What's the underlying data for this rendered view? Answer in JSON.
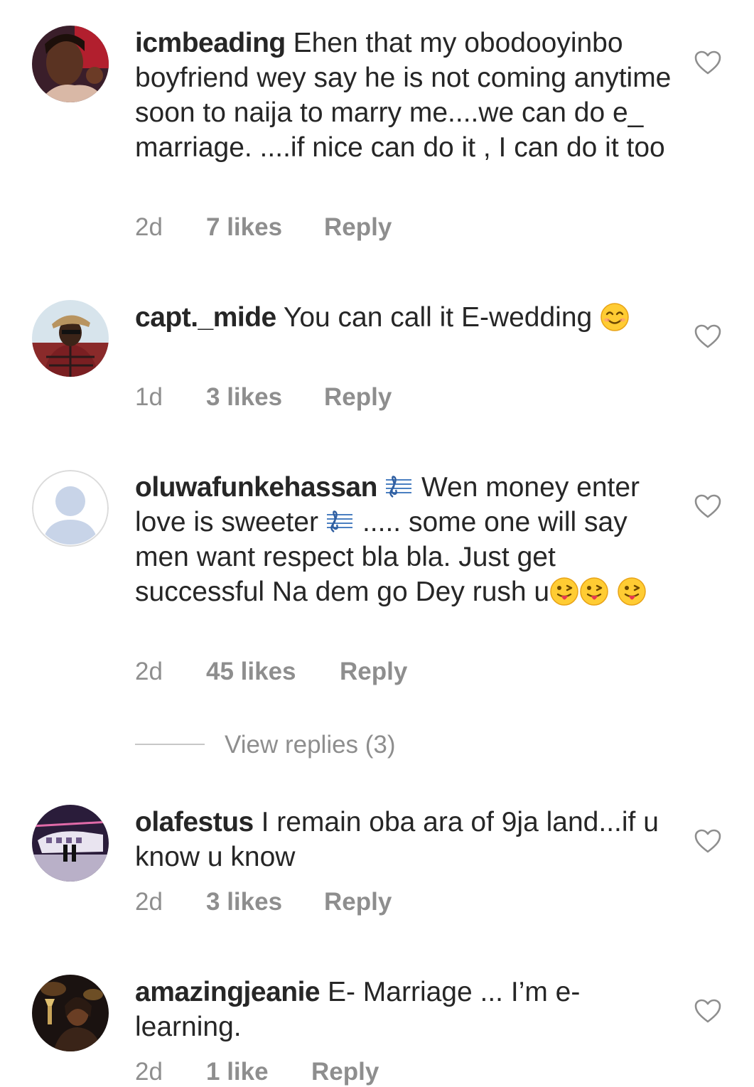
{
  "colors": {
    "text": "#262626",
    "secondary": "#8e8e8e",
    "background": "#ffffff"
  },
  "comments": [
    {
      "username": "icmbeading",
      "text": "Ehen that my obodooyinbo boyfriend wey say he is not coming anytime soon to naija to marry me....we can do e_ marriage. ....if nice can do it , I can do it too",
      "time": "2d",
      "likes": "7 likes",
      "reply": "Reply",
      "avatar_icon": "user-photo-avatar"
    },
    {
      "username": "capt._mide",
      "text": "You can call it E-wedding",
      "emoji": "smiling-face-emoji",
      "time": "1d",
      "likes": "3 likes",
      "reply": "Reply",
      "avatar_icon": "user-photo-avatar"
    },
    {
      "username": "oluwafunkehassan",
      "text_part1": "Wen money enter love is sweeter",
      "text_part2": "..... some one will say men want respect bla bla. Just get successful Na dem go Dey rush u",
      "music_icon": "musical-score-emoji",
      "emoji": "winking-tongue-emoji",
      "time": "2d",
      "likes": "45 likes",
      "reply": "Reply",
      "avatar_icon": "default-user-avatar"
    },
    {
      "username": "olafestus",
      "text": "I remain oba ara of 9ja land...if u know u know",
      "time": "2d",
      "likes": "3 likes",
      "reply": "Reply",
      "avatar_icon": "user-photo-avatar"
    },
    {
      "username": "amazingjeanie",
      "text": "E- Marriage ... I’m e-learning.",
      "time": "2d",
      "likes": "1 like",
      "reply": "Reply",
      "avatar_icon": "user-photo-avatar"
    }
  ],
  "view_replies": "View replies (3)"
}
